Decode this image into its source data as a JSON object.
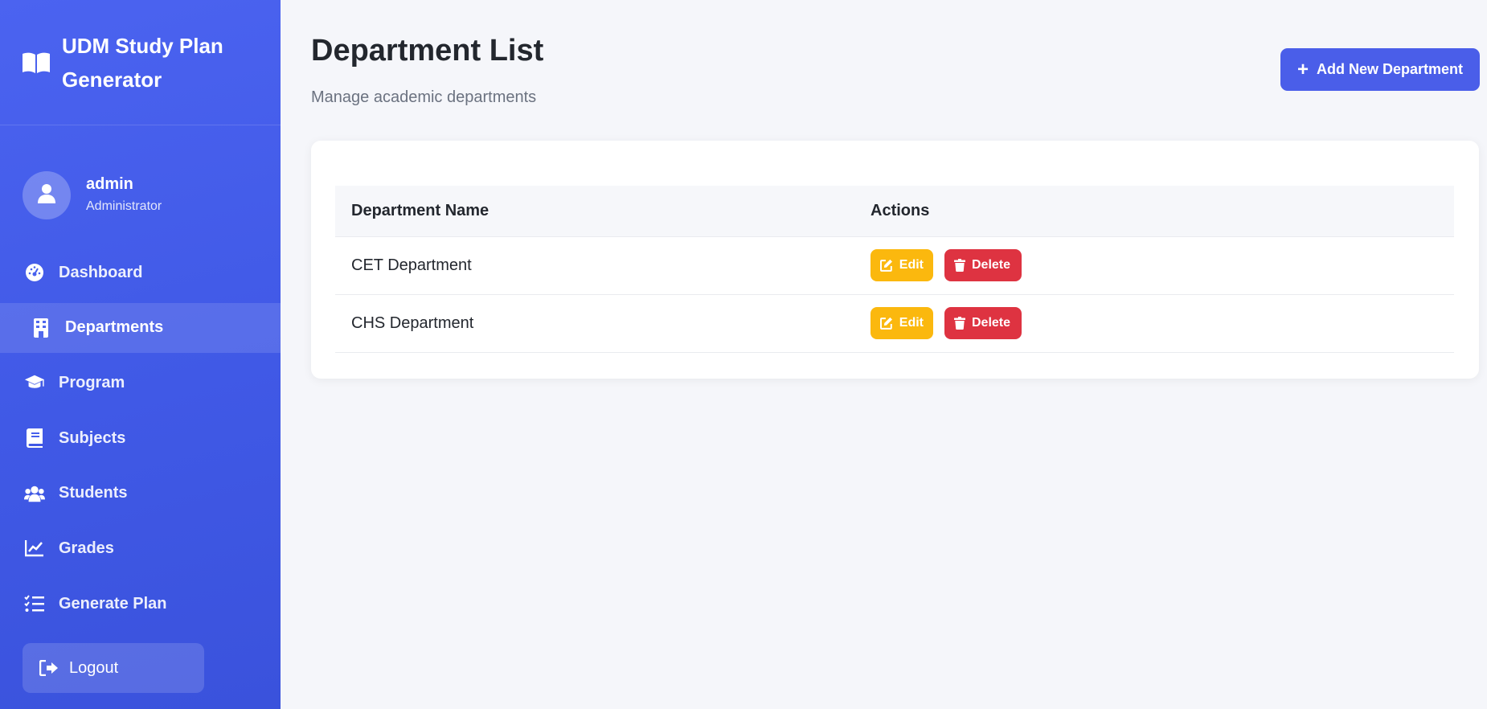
{
  "sidebar": {
    "brand_title": "UDM Study Plan Generator",
    "user": {
      "name": "admin",
      "role": "Administrator"
    },
    "items": [
      {
        "label": "Dashboard",
        "icon": "gauge-icon"
      },
      {
        "label": "Departments",
        "icon": "building-icon",
        "active": true
      },
      {
        "label": "Program",
        "icon": "graduation-cap-icon"
      },
      {
        "label": "Subjects",
        "icon": "book-icon"
      },
      {
        "label": "Students",
        "icon": "users-icon"
      },
      {
        "label": "Grades",
        "icon": "chart-line-icon"
      },
      {
        "label": "Generate Plan",
        "icon": "list-check-icon"
      }
    ],
    "logout_label": "Logout"
  },
  "header": {
    "title": "Department List",
    "subtitle": "Manage academic departments",
    "add_button_label": "Add New Department"
  },
  "table": {
    "columns": [
      "Department Name",
      "Actions"
    ],
    "rows": [
      {
        "name": "CET Department",
        "edit_label": "Edit",
        "delete_label": "Delete"
      },
      {
        "name": "CHS Department",
        "edit_label": "Edit",
        "delete_label": "Delete"
      }
    ]
  },
  "colors": {
    "sidebar": "#4b63f0",
    "primary": "#4a5ee9",
    "edit": "#fbb80e",
    "delete": "#de3341",
    "background": "#f5f6fa"
  }
}
